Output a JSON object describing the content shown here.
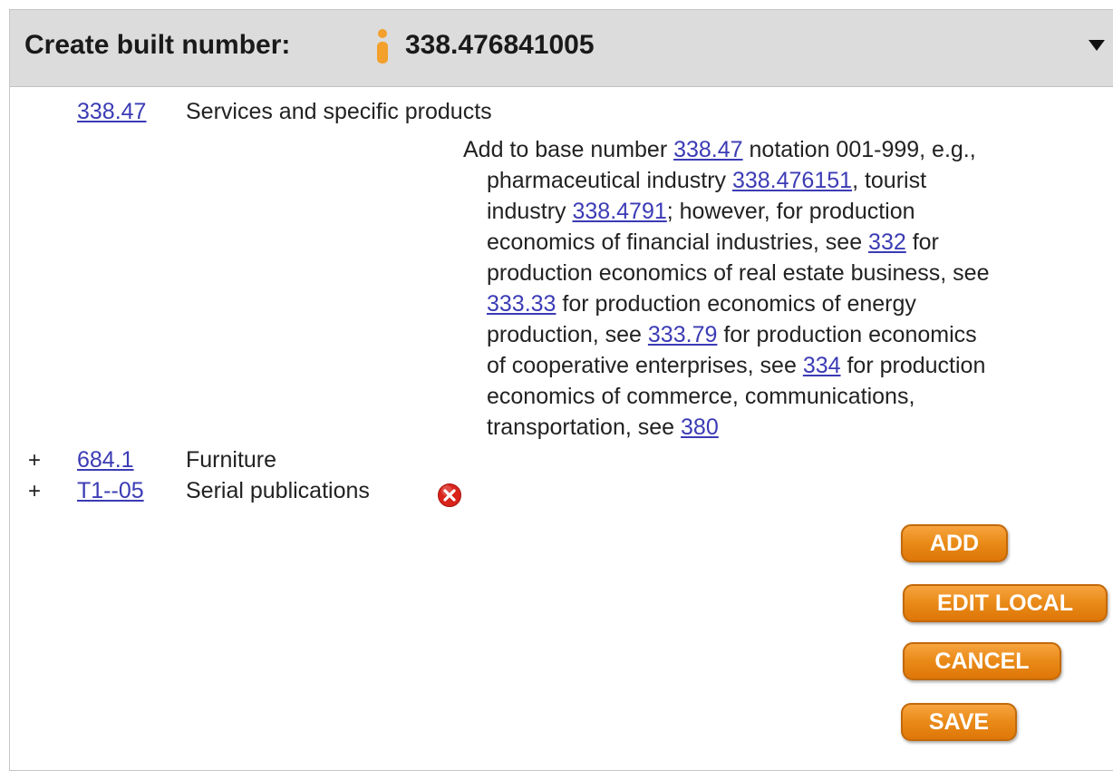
{
  "header": {
    "title": "Create built number:",
    "number": "338.476841005"
  },
  "entries": [
    {
      "notation": "338.47",
      "caption": "Services and specific products",
      "expandable": false
    },
    {
      "notation": "684.1",
      "caption": "Furniture",
      "expandable": true
    },
    {
      "notation": "T1--05",
      "caption": "Serial publications",
      "expandable": true
    }
  ],
  "note": {
    "t1": "Add to base number ",
    "l1": "338.47",
    "t2": " notation 001-999, e.g.,",
    "t3": "pharmaceutical industry ",
    "l2": "338.476151",
    "t4": ", tourist",
    "t5": "industry ",
    "l3": "338.4791",
    "t6": "; however, for production",
    "t7": "economics of financial industries, see ",
    "l4": "332",
    "t8": " for",
    "t9": "production economics of real estate business, see",
    "l5": "333.33",
    "t10": " for production economics of energy",
    "t11": "production, see ",
    "l6": "333.79",
    "t12": " for production economics",
    "t13": "of cooperative enterprises, see ",
    "l7": "334",
    "t14": " for production",
    "t15": "economics of commerce, communications,",
    "t16": "transportation, see ",
    "l8": "380"
  },
  "expand_symbol": "+",
  "buttons": {
    "add": "ADD",
    "edit_local": "EDIT LOCAL",
    "cancel": "CANCEL",
    "save": "SAVE"
  },
  "icons": {
    "person": "person-icon",
    "dropdown": "triangle-down-icon",
    "remove": "remove-icon"
  },
  "colors": {
    "header_bg": "#dcdcdc",
    "link": "#3b3bb5",
    "button_orange": "#e98a17",
    "remove_red": "#d9241c",
    "person_orange": "#f3a02c"
  }
}
